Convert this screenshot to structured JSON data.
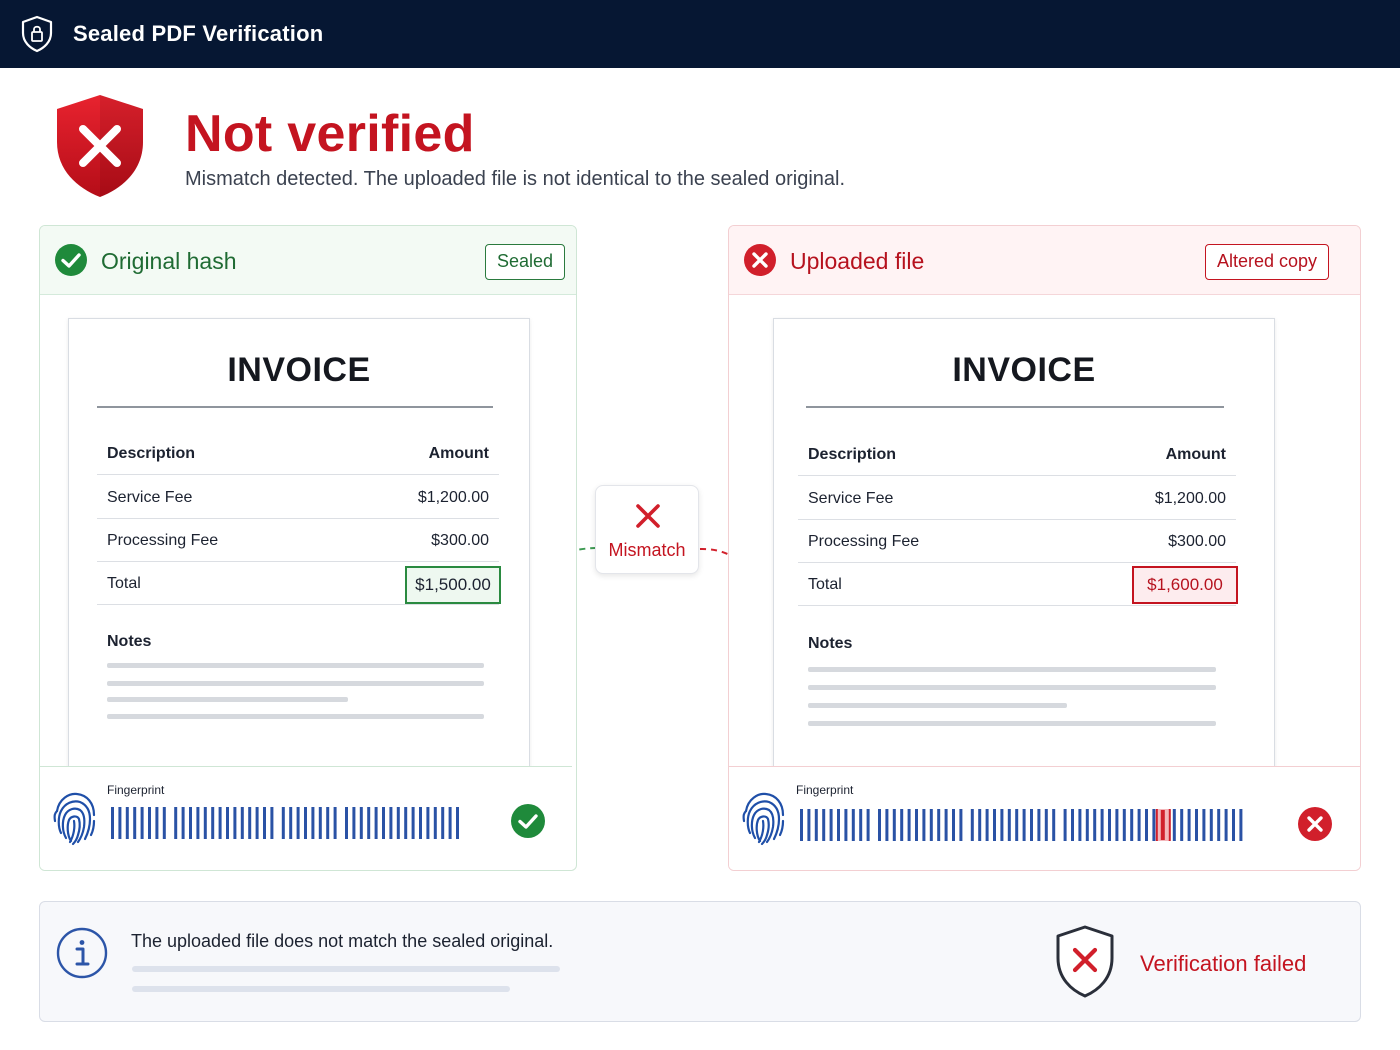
{
  "app": {
    "title": "Sealed PDF Verification",
    "icon": "shield-lock-icon"
  },
  "status": {
    "title": "Not verified",
    "subtitle": "Mismatch detected. The uploaded file is not identical to the sealed original.",
    "icon": "shield-x-icon",
    "color": "#c41420"
  },
  "original": {
    "title": "Original hash",
    "badge": "Sealed",
    "icon": "check-circle-icon",
    "accent": "#1f6b33",
    "document": {
      "title": "INVOICE",
      "headers": [
        "Description",
        "Amount"
      ],
      "rows": [
        [
          "Service Fee",
          "$1,200.00"
        ],
        [
          "Processing Fee",
          "$300.00"
        ]
      ],
      "total_label": "Total",
      "total_value": "$1,500.00",
      "notes_label": "Notes"
    },
    "fingerprint": {
      "label": "Fingerprint",
      "status": "match"
    }
  },
  "uploaded": {
    "title": "Uploaded file",
    "badge": "Altered copy",
    "icon": "x-circle-icon",
    "accent": "#b6121e",
    "document": {
      "title": "INVOICE",
      "headers": [
        "Description",
        "Amount"
      ],
      "rows": [
        [
          "Service Fee",
          "$1,200.00"
        ],
        [
          "Processing Fee",
          "$300.00"
        ]
      ],
      "total_label": "Total",
      "total_value": "$1,600.00",
      "notes_label": "Notes"
    },
    "fingerprint": {
      "label": "Fingerprint",
      "status": "mismatch"
    }
  },
  "comparison": {
    "label": "Mismatch",
    "icon": "x-mark-icon"
  },
  "info": {
    "message": "The uploaded file does not match the sealed original.",
    "result": "Verification failed",
    "icon": "info-icon",
    "result_icon": "shield-x-icon"
  }
}
